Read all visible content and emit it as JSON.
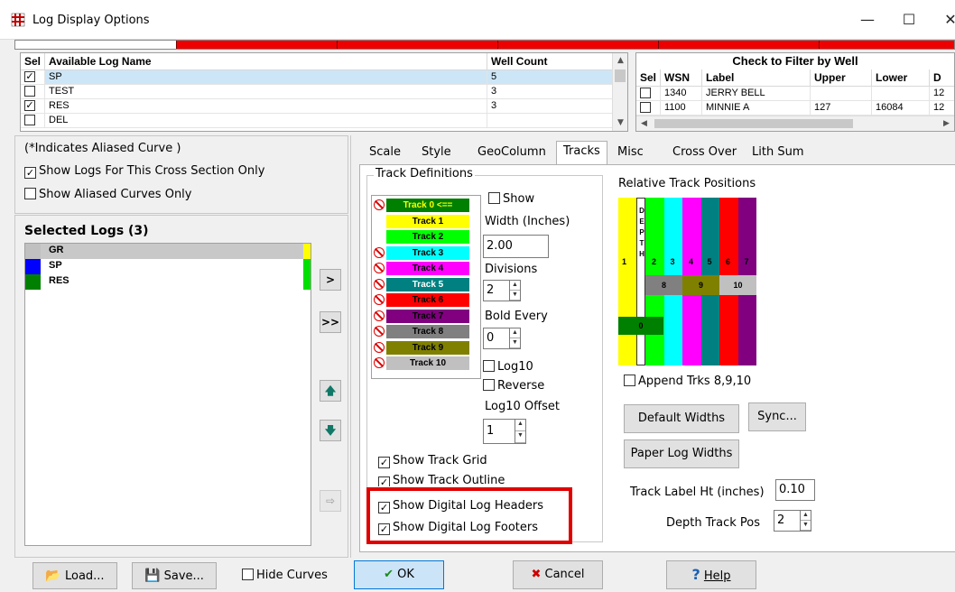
{
  "window": {
    "title": "Log Display Options",
    "minimize": "—",
    "maximize": "☐",
    "close": "✕"
  },
  "available_logs": {
    "headers": [
      "Sel",
      "Available Log Name",
      "Well Count"
    ],
    "rows": [
      {
        "checked": true,
        "name": "SP",
        "count": "5"
      },
      {
        "checked": false,
        "name": "TEST",
        "count": "3"
      },
      {
        "checked": true,
        "name": "RES",
        "count": "3"
      },
      {
        "checked": false,
        "name": "DEL",
        "count": ""
      }
    ]
  },
  "well_filter": {
    "title": "Check to Filter by Well",
    "headers": [
      "Sel",
      "WSN",
      "Label",
      "Upper",
      "Lower",
      "D"
    ],
    "rows": [
      {
        "wsn": "1340",
        "label": "JERRY BELL",
        "upper": "",
        "lower": "",
        "d": "12"
      },
      {
        "wsn": "1100",
        "label": "MINNIE A",
        "upper": "127",
        "lower": "16084",
        "d": "12"
      }
    ]
  },
  "left": {
    "aliased_note": "(*Indicates Aliased Curve )",
    "show_cross_section": "Show Logs For This Cross Section Only",
    "show_aliased_only": "Show Aliased Curves Only",
    "selected_title": "Selected Logs (3)",
    "selected_logs": [
      {
        "name": "GR",
        "color": "#c0c0c0",
        "bar": "#ffff00"
      },
      {
        "name": "SP",
        "color": "#0000ff",
        "bar": "#00e000"
      },
      {
        "name": "RES",
        "color": "#008000",
        "bar": ""
      }
    ],
    "btn_add": ">",
    "btn_add_all": ">>",
    "btn_up": "🡅",
    "btn_down": "🡇",
    "btn_export": "⇨"
  },
  "tabs": [
    "Scale",
    "Style",
    "GeoColumn",
    "Tracks",
    "Misc",
    "Cross Over",
    "Lith Sum"
  ],
  "active_tab": "Tracks",
  "tracks": {
    "group_label": "Track Definitions",
    "items": [
      {
        "label": "Track 0 <==",
        "bg": "#008000",
        "fg": "#ffff00",
        "no": true
      },
      {
        "label": "Track 1",
        "bg": "#ffff00",
        "fg": "#000",
        "no": false
      },
      {
        "label": "Track 2",
        "bg": "#00ff00",
        "fg": "#000",
        "no": false
      },
      {
        "label": "Track 3",
        "bg": "#00ffff",
        "fg": "#000",
        "no": true
      },
      {
        "label": "Track 4",
        "bg": "#ff00ff",
        "fg": "#000",
        "no": true
      },
      {
        "label": "Track 5",
        "bg": "#008080",
        "fg": "#fff",
        "no": true
      },
      {
        "label": "Track 6",
        "bg": "#ff0000",
        "fg": "#000",
        "no": true
      },
      {
        "label": "Track 7",
        "bg": "#800080",
        "fg": "#000",
        "no": true
      },
      {
        "label": "Track 8",
        "bg": "#808080",
        "fg": "#000",
        "no": true
      },
      {
        "label": "Track 9",
        "bg": "#808000",
        "fg": "#000",
        "no": true
      },
      {
        "label": "Track 10",
        "bg": "#c0c0c0",
        "fg": "#000",
        "no": true
      }
    ],
    "show_label": "Show",
    "width_label": "Width (Inches)",
    "width_value": "2.00",
    "divisions_label": "Divisions",
    "divisions_value": "2",
    "bold_every_label": "Bold Every",
    "bold_every_value": "0",
    "log10_label": "Log10",
    "reverse_label": "Reverse",
    "log10_offset_label": "Log10 Offset",
    "log10_offset_value": "1",
    "show_grid": "Show Track Grid",
    "show_outline": "Show Track Outline",
    "show_headers": "Show Digital Log Headers",
    "show_footers": "Show Digital Log Footers"
  },
  "relative": {
    "title": "Relative Track Positions",
    "depth_letters": "DEPTH",
    "append_label": "Append Trks 8,9,10",
    "default_widths": "Default Widths",
    "sync": "Sync...",
    "paper_widths": "Paper Log Widths",
    "label_ht_label": "Track Label Ht (inches)",
    "label_ht_value": "0.10",
    "depth_pos_label": "Depth Track Pos",
    "depth_pos_value": "2",
    "cols": [
      {
        "n": "1",
        "bg": "#ffff00"
      },
      {
        "n": "2",
        "bg": "#00ff00"
      },
      {
        "n": "3",
        "bg": "#00ffff"
      },
      {
        "n": "4",
        "bg": "#ff00ff"
      },
      {
        "n": "5",
        "bg": "#008080"
      },
      {
        "n": "6",
        "bg": "#ff0000"
      },
      {
        "n": "7",
        "bg": "#800080"
      }
    ],
    "row": [
      {
        "n": "8",
        "bg": "#808080"
      },
      {
        "n": "9",
        "bg": "#808000"
      },
      {
        "n": "10",
        "bg": "#c0c0c0"
      }
    ],
    "track0": {
      "n": "0",
      "bg": "#008000"
    }
  },
  "bottom": {
    "load": "Load...",
    "save": "Save...",
    "hide_curves": "Hide Curves",
    "ok": "OK",
    "cancel": "Cancel",
    "help": "Help"
  },
  "colors": {
    "highlight_box": "#e00000",
    "stripe": "#e00000"
  }
}
